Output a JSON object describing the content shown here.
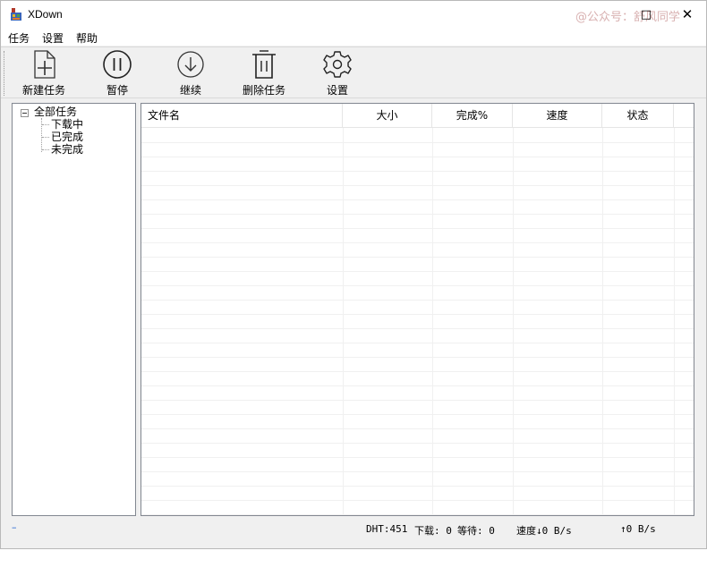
{
  "window": {
    "title": "XDown",
    "watermark": "@公众号：舒风同学",
    "maximize_glyph": "□",
    "close_glyph": "✕"
  },
  "menu": [
    {
      "label": "任务"
    },
    {
      "label": "设置"
    },
    {
      "label": "帮助"
    }
  ],
  "toolbar": [
    {
      "label": "新建任务",
      "icon": "new-file-icon"
    },
    {
      "label": "暂停",
      "icon": "pause-icon"
    },
    {
      "label": "继续",
      "icon": "download-arrow-icon"
    },
    {
      "label": "删除任务",
      "icon": "trash-icon"
    },
    {
      "label": "设置",
      "icon": "gear-icon"
    }
  ],
  "tree": {
    "root": "全部任务",
    "children": [
      "下载中",
      "已完成",
      "未完成"
    ]
  },
  "list": {
    "columns": [
      "文件名",
      "大小",
      "完成%",
      "速度",
      "状态"
    ],
    "rows": []
  },
  "status": {
    "dash": "–",
    "dht": "DHT:451",
    "downloading": "下载: 0",
    "waiting": "等待: 0",
    "download_speed": "速度↓0 B/s",
    "upload_speed": "↑0 B/s"
  }
}
